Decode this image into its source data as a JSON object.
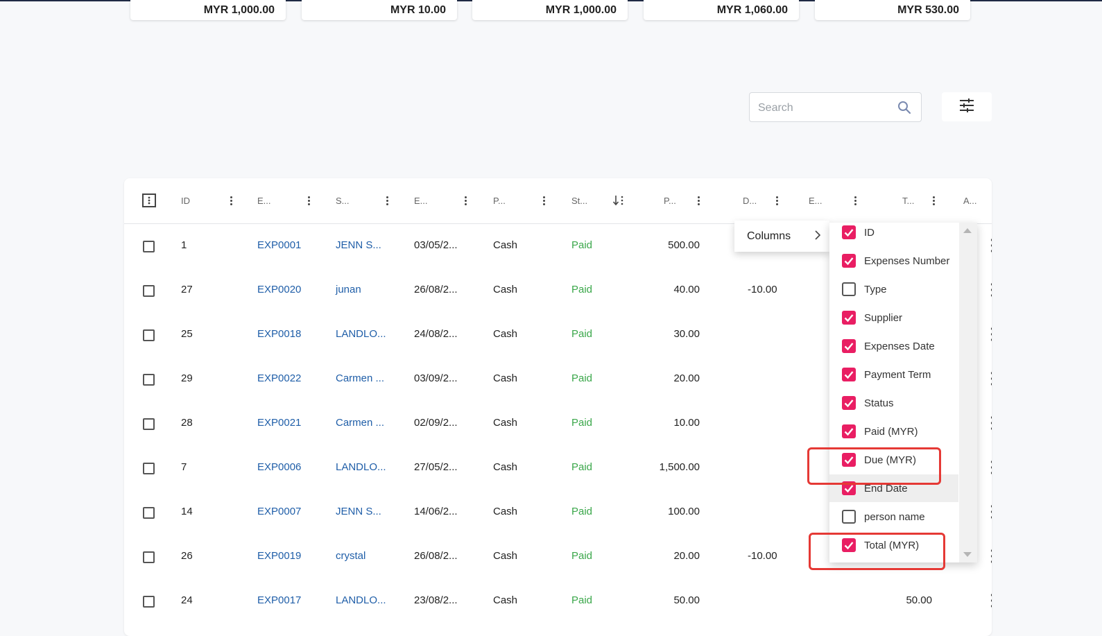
{
  "summary_cards": [
    "MYR 1,000.00",
    "MYR 10.00",
    "MYR 1,000.00",
    "MYR 1,060.00",
    "MYR 530.00"
  ],
  "search": {
    "placeholder": "Search"
  },
  "table": {
    "headers": [
      "ID",
      "E...",
      "S...",
      "E...",
      "P...",
      "St...",
      "P...",
      "D...",
      "E...",
      "T...",
      "A..."
    ],
    "rows": [
      {
        "id": "1",
        "number": "EXP0001",
        "supplier": "JENN S...",
        "date": "03/05/2...",
        "term": "Cash",
        "status": "Paid",
        "paid": "500.00",
        "due": "",
        "total": ""
      },
      {
        "id": "27",
        "number": "EXP0020",
        "supplier": "junan",
        "date": "26/08/2...",
        "term": "Cash",
        "status": "Paid",
        "paid": "40.00",
        "due": "-10.00",
        "total": ""
      },
      {
        "id": "25",
        "number": "EXP0018",
        "supplier": "LANDLO...",
        "date": "24/08/2...",
        "term": "Cash",
        "status": "Paid",
        "paid": "30.00",
        "due": "",
        "total": ""
      },
      {
        "id": "29",
        "number": "EXP0022",
        "supplier": "Carmen ...",
        "date": "03/09/2...",
        "term": "Cash",
        "status": "Paid",
        "paid": "20.00",
        "due": "",
        "total": ""
      },
      {
        "id": "28",
        "number": "EXP0021",
        "supplier": "Carmen ...",
        "date": "02/09/2...",
        "term": "Cash",
        "status": "Paid",
        "paid": "10.00",
        "due": "",
        "total": ""
      },
      {
        "id": "7",
        "number": "EXP0006",
        "supplier": "LANDLO...",
        "date": "27/05/2...",
        "term": "Cash",
        "status": "Paid",
        "paid": "1,500.00",
        "due": "",
        "total": ""
      },
      {
        "id": "14",
        "number": "EXP0007",
        "supplier": "JENN S...",
        "date": "14/06/2...",
        "term": "Cash",
        "status": "Paid",
        "paid": "100.00",
        "due": "",
        "total": ""
      },
      {
        "id": "26",
        "number": "EXP0019",
        "supplier": "crystal",
        "date": "26/08/2...",
        "term": "Cash",
        "status": "Paid",
        "paid": "20.00",
        "due": "-10.00",
        "total": ""
      },
      {
        "id": "24",
        "number": "EXP0017",
        "supplier": "LANDLO...",
        "date": "23/08/2...",
        "term": "Cash",
        "status": "Paid",
        "paid": "50.00",
        "due": "",
        "total": "50.00"
      }
    ]
  },
  "context_menu": {
    "label": "Columns"
  },
  "columns_panel": [
    {
      "label": "ID",
      "checked": true
    },
    {
      "label": "Expenses Number",
      "checked": true
    },
    {
      "label": "Type",
      "checked": false
    },
    {
      "label": "Supplier",
      "checked": true
    },
    {
      "label": "Expenses Date",
      "checked": true
    },
    {
      "label": "Payment Term",
      "checked": true
    },
    {
      "label": "Status",
      "checked": true
    },
    {
      "label": "Paid (MYR)",
      "checked": true
    },
    {
      "label": "Due (MYR)",
      "checked": true
    },
    {
      "label": "End Date",
      "checked": true
    },
    {
      "label": "person name",
      "checked": false
    },
    {
      "label": "Total (MYR)",
      "checked": true
    }
  ],
  "colors": {
    "accent": "#e91e63",
    "link": "#1f5ea8",
    "paid": "#3aa74a",
    "highlight": "#e53935"
  }
}
